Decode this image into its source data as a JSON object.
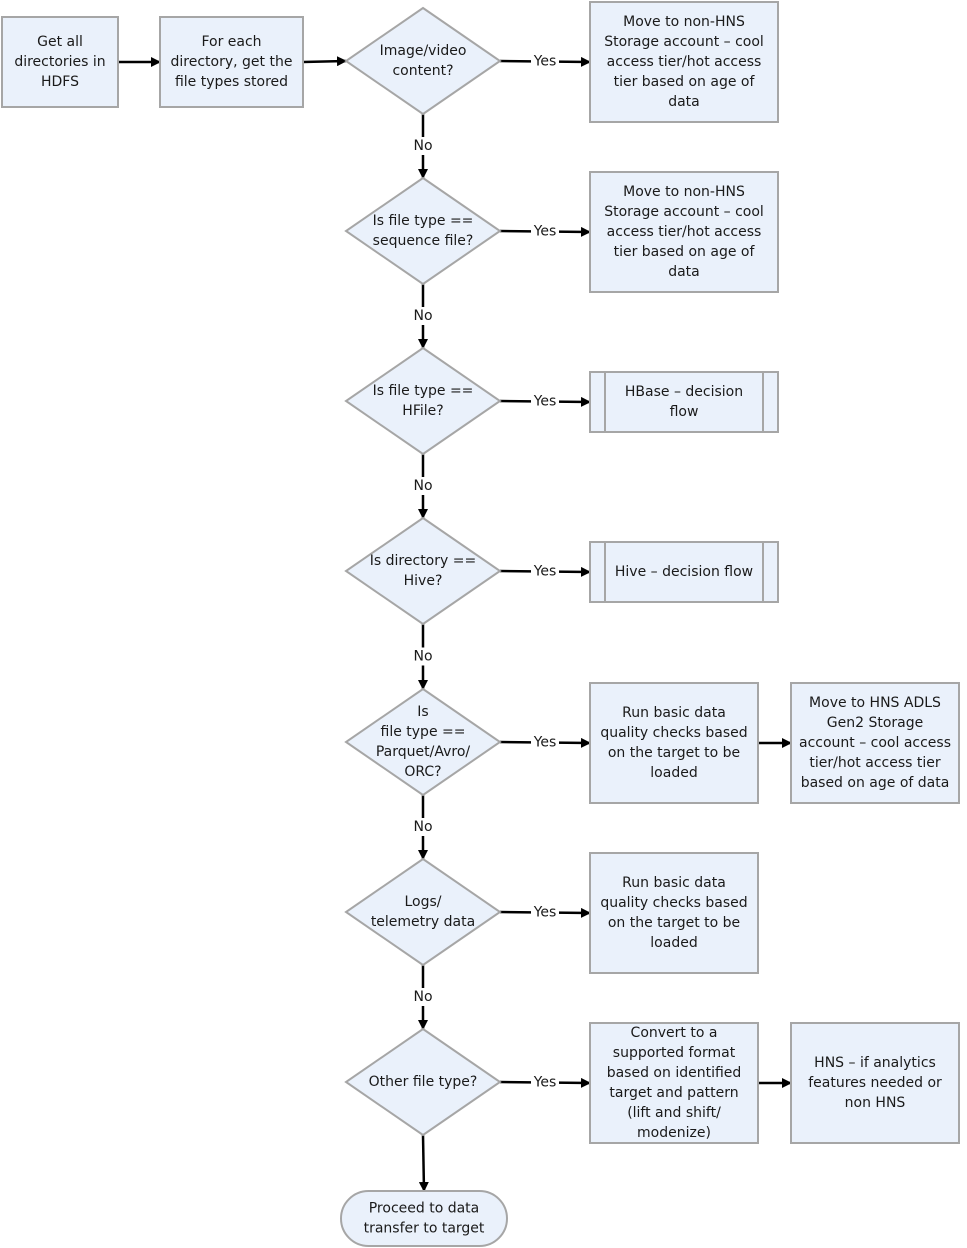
{
  "diagram": {
    "type": "flowchart",
    "colors": {
      "fill": "#eaf1fb",
      "stroke": "#a6a6a6",
      "edge": "#000000",
      "text": "#1a1a1a"
    },
    "nodes": [
      {
        "id": "get_dirs",
        "shape": "process",
        "lines": [
          "Get all",
          "directories in",
          "HDFS"
        ]
      },
      {
        "id": "get_types",
        "shape": "process",
        "lines": [
          "For each",
          "directory, get the",
          "file types stored"
        ]
      },
      {
        "id": "d_image",
        "shape": "decision",
        "lines": [
          "Image/video",
          "content?"
        ]
      },
      {
        "id": "r_image",
        "shape": "process",
        "lines": [
          "Move to non-HNS",
          "Storage account – cool",
          "access tier/hot access",
          "tier based on age of",
          "data"
        ]
      },
      {
        "id": "d_seq",
        "shape": "decision",
        "lines": [
          "Is file type ==",
          "sequence file?"
        ]
      },
      {
        "id": "r_seq",
        "shape": "process",
        "lines": [
          "Move to non-HNS",
          "Storage account – cool",
          "access tier/hot access",
          "tier based on age of",
          "data"
        ]
      },
      {
        "id": "d_hfile",
        "shape": "decision",
        "lines": [
          "Is file type ==",
          "HFile?"
        ]
      },
      {
        "id": "r_hbase",
        "shape": "subprocess",
        "lines": [
          "HBase – decision",
          "flow"
        ]
      },
      {
        "id": "d_hive",
        "shape": "decision",
        "lines": [
          "Is directory ==",
          "Hive?"
        ]
      },
      {
        "id": "r_hive",
        "shape": "subprocess",
        "lines": [
          "Hive – decision flow"
        ]
      },
      {
        "id": "d_parquet",
        "shape": "decision",
        "lines": [
          "Is",
          "file type ==",
          "Parquet/Avro/",
          "ORC?"
        ]
      },
      {
        "id": "r_parquet_dq",
        "shape": "process",
        "lines": [
          "Run basic data",
          "quality checks based",
          "on the target to be",
          "loaded"
        ]
      },
      {
        "id": "r_parquet_move",
        "shape": "process",
        "lines": [
          "Move to HNS ADLS",
          "Gen2 Storage",
          "account – cool access",
          "tier/hot access tier",
          "based on age of data"
        ]
      },
      {
        "id": "d_logs",
        "shape": "decision",
        "lines": [
          "Logs/",
          "telemetry data"
        ]
      },
      {
        "id": "r_logs_dq",
        "shape": "process",
        "lines": [
          "Run basic data",
          "quality checks based",
          "on the target to be",
          "loaded"
        ]
      },
      {
        "id": "d_other",
        "shape": "decision",
        "lines": [
          "Other file type?"
        ]
      },
      {
        "id": "r_convert",
        "shape": "process",
        "lines": [
          "Convert to a",
          "supported format",
          "based on identified",
          "target and pattern",
          "(lift and shift/",
          "modenize)"
        ]
      },
      {
        "id": "r_hns",
        "shape": "process",
        "lines": [
          "HNS – if analytics",
          "features needed or",
          "non HNS"
        ]
      },
      {
        "id": "end",
        "shape": "terminator",
        "lines": [
          "Proceed to data",
          "transfer to target"
        ]
      }
    ],
    "edges": [
      {
        "from": "get_dirs",
        "to": "get_types",
        "label": ""
      },
      {
        "from": "get_types",
        "to": "d_image",
        "label": ""
      },
      {
        "from": "d_image",
        "to": "r_image",
        "label": "Yes"
      },
      {
        "from": "d_image",
        "to": "d_seq",
        "label": "No"
      },
      {
        "from": "d_seq",
        "to": "r_seq",
        "label": "Yes"
      },
      {
        "from": "d_seq",
        "to": "d_hfile",
        "label": "No"
      },
      {
        "from": "d_hfile",
        "to": "r_hbase",
        "label": "Yes"
      },
      {
        "from": "d_hfile",
        "to": "d_hive",
        "label": "No"
      },
      {
        "from": "d_hive",
        "to": "r_hive",
        "label": "Yes"
      },
      {
        "from": "d_hive",
        "to": "d_parquet",
        "label": "No"
      },
      {
        "from": "d_parquet",
        "to": "r_parquet_dq",
        "label": "Yes"
      },
      {
        "from": "r_parquet_dq",
        "to": "r_parquet_move",
        "label": ""
      },
      {
        "from": "d_parquet",
        "to": "d_logs",
        "label": "No"
      },
      {
        "from": "d_logs",
        "to": "r_logs_dq",
        "label": "Yes"
      },
      {
        "from": "d_logs",
        "to": "d_other",
        "label": "No"
      },
      {
        "from": "d_other",
        "to": "r_convert",
        "label": "Yes"
      },
      {
        "from": "r_convert",
        "to": "r_hns",
        "label": ""
      },
      {
        "from": "d_other",
        "to": "end",
        "label": ""
      }
    ]
  }
}
